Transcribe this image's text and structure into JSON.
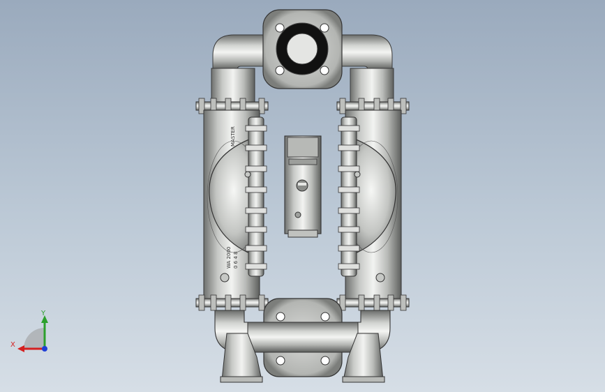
{
  "viewport": {
    "background_top": "#9aaabd",
    "background_bottom": "#d6dee6"
  },
  "model": {
    "type": "air-operated double diaphragm pump",
    "view": "front",
    "material_color": "#c9cbc8",
    "markings": {
      "brand": "MASTER",
      "codes": [
        "WA 2000",
        "0 6 4 8"
      ]
    }
  },
  "triad": {
    "x_label": "X",
    "y_label": "Y",
    "x_color": "#d42020",
    "y_color": "#2ca02c",
    "z_color": "#1f3fd6"
  }
}
